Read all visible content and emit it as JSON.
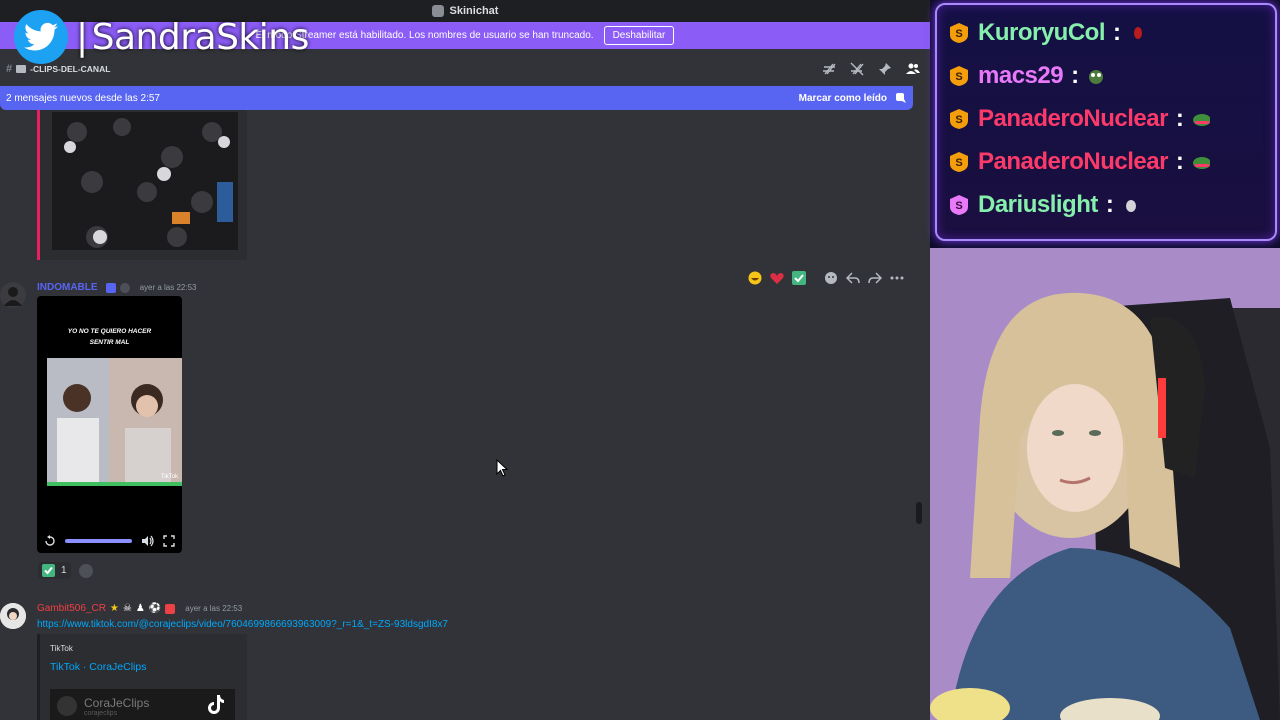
{
  "window": {
    "title": "Skinichat"
  },
  "notice": {
    "text": "El modo Streamer está habilitado. Los nombres de usuario se han truncado.",
    "button": "Deshabilitar"
  },
  "brand": {
    "handle": "SandraSkins"
  },
  "channel": {
    "name": "-CLIPS-DEL-CANAL"
  },
  "new_messages": {
    "text": "2 mensajes nuevos desde las 2:57",
    "mark_read": "Marcar como leído"
  },
  "messages": [
    {
      "username": "INDOMABLE",
      "username_color": "#5865f2",
      "timestamp": "ayer a las 22:53",
      "video": {
        "caption_line1": "YO NO TE QUIERO HACER",
        "caption_line2": "SENTIR MAL",
        "watermark": "TikTok"
      },
      "reactions": [
        {
          "emoji": "check",
          "count": "1"
        }
      ]
    },
    {
      "username": "Gambit506_CR",
      "username_color": "#f23f42",
      "timestamp": "ayer a las 22:53",
      "link": "https://www.tiktok.com/@corajeclips/video/7604699866693963009?_r=1&_t=ZS-93ldsgdI8x7",
      "embed": {
        "provider": "TikTok",
        "title": "TikTok · CoraJeClips",
        "preview_name": "CoraJeClips",
        "preview_handle": "corajeclips"
      }
    }
  ],
  "chat": [
    {
      "name": "KuroryuCol",
      "color": "#86efac",
      "badge_color": "#f59e0b"
    },
    {
      "name": "macs29",
      "color": "#e879f9",
      "badge_color": "#f59e0b"
    },
    {
      "name": "PanaderoNuclear",
      "color": "#fb3a6a",
      "badge_color": "#f59e0b"
    },
    {
      "name": "PanaderoNuclear",
      "color": "#fb3a6a",
      "badge_color": "#f59e0b"
    },
    {
      "name": "Dariuslight",
      "color": "#86efac",
      "badge_color": "#e879f9"
    }
  ],
  "icons": [
    "twitter-icon",
    "hash-icon",
    "threads-icon",
    "mute-icon",
    "pin-icon",
    "members-icon",
    "mark-read-icon",
    "replay-icon",
    "volume-icon",
    "fullscreen-icon",
    "add-reaction-icon",
    "reply-icon",
    "forward-icon",
    "more-icon"
  ]
}
